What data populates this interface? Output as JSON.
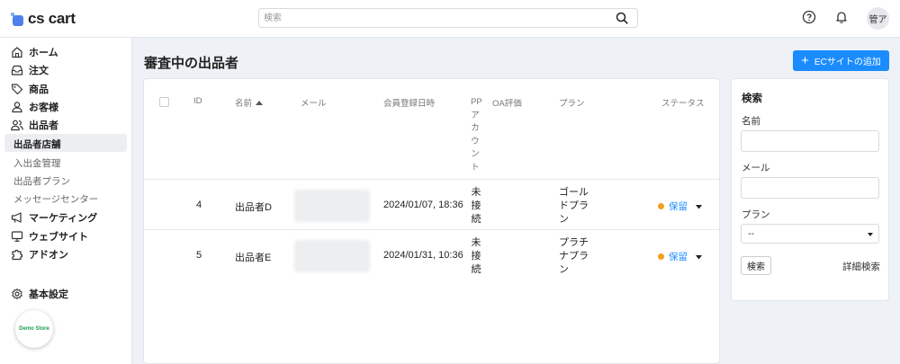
{
  "app": {
    "logo_text": "cs cart"
  },
  "header": {
    "search_placeholder": "検索",
    "avatar_text": "管ア"
  },
  "sidebar": {
    "items": [
      {
        "label": "ホーム",
        "icon": "home-icon"
      },
      {
        "label": "注文",
        "icon": "inbox-icon"
      },
      {
        "label": "商品",
        "icon": "tag-icon"
      },
      {
        "label": "お客様",
        "icon": "person-icon"
      },
      {
        "label": "出品者",
        "icon": "people-icon"
      },
      {
        "label": "マーケティング",
        "icon": "megaphone-icon"
      },
      {
        "label": "ウェブサイト",
        "icon": "monitor-icon"
      },
      {
        "label": "アドオン",
        "icon": "puzzle-icon"
      },
      {
        "label": "基本設定",
        "icon": "gear-icon"
      }
    ],
    "sub_items": [
      "出品者店舗",
      "入出金管理",
      "出品者プラン",
      "メッセージセンター"
    ],
    "active_sub": "出品者店舗",
    "demo_badge": "Demo Store"
  },
  "main": {
    "title": "審査中の出品者",
    "add_button": "ECサイトの追加",
    "columns": {
      "id": "ID",
      "name": "名前",
      "email": "メール",
      "registered": "会員登録日時",
      "pp_account": "PPアカウント",
      "oa_rating": "OA評価",
      "plan": "プラン",
      "status": "ステータス"
    },
    "rows": [
      {
        "id": "4",
        "name": "出品者D",
        "registered": "2024/01/07, 18:36",
        "pp_account": "未接続",
        "plan_line1": "ゴール",
        "plan_line2": "ドプラ",
        "plan_line3": "ン",
        "status": "保留"
      },
      {
        "id": "5",
        "name": "出品者E",
        "registered": "2024/01/31, 10:36",
        "pp_account": "未接続",
        "plan_line1": "プラチ",
        "plan_line2": "ナプラ",
        "plan_line3": "ン",
        "status": "保留"
      }
    ]
  },
  "search_panel": {
    "title": "検索",
    "name_label": "名前",
    "email_label": "メール",
    "plan_label": "プラン",
    "plan_value": "--",
    "search_button": "検索",
    "advanced_link": "詳細検索"
  },
  "colors": {
    "accent": "#1a8cff",
    "status_pending": "#f59f1e",
    "logo": "#4f7fe8"
  }
}
